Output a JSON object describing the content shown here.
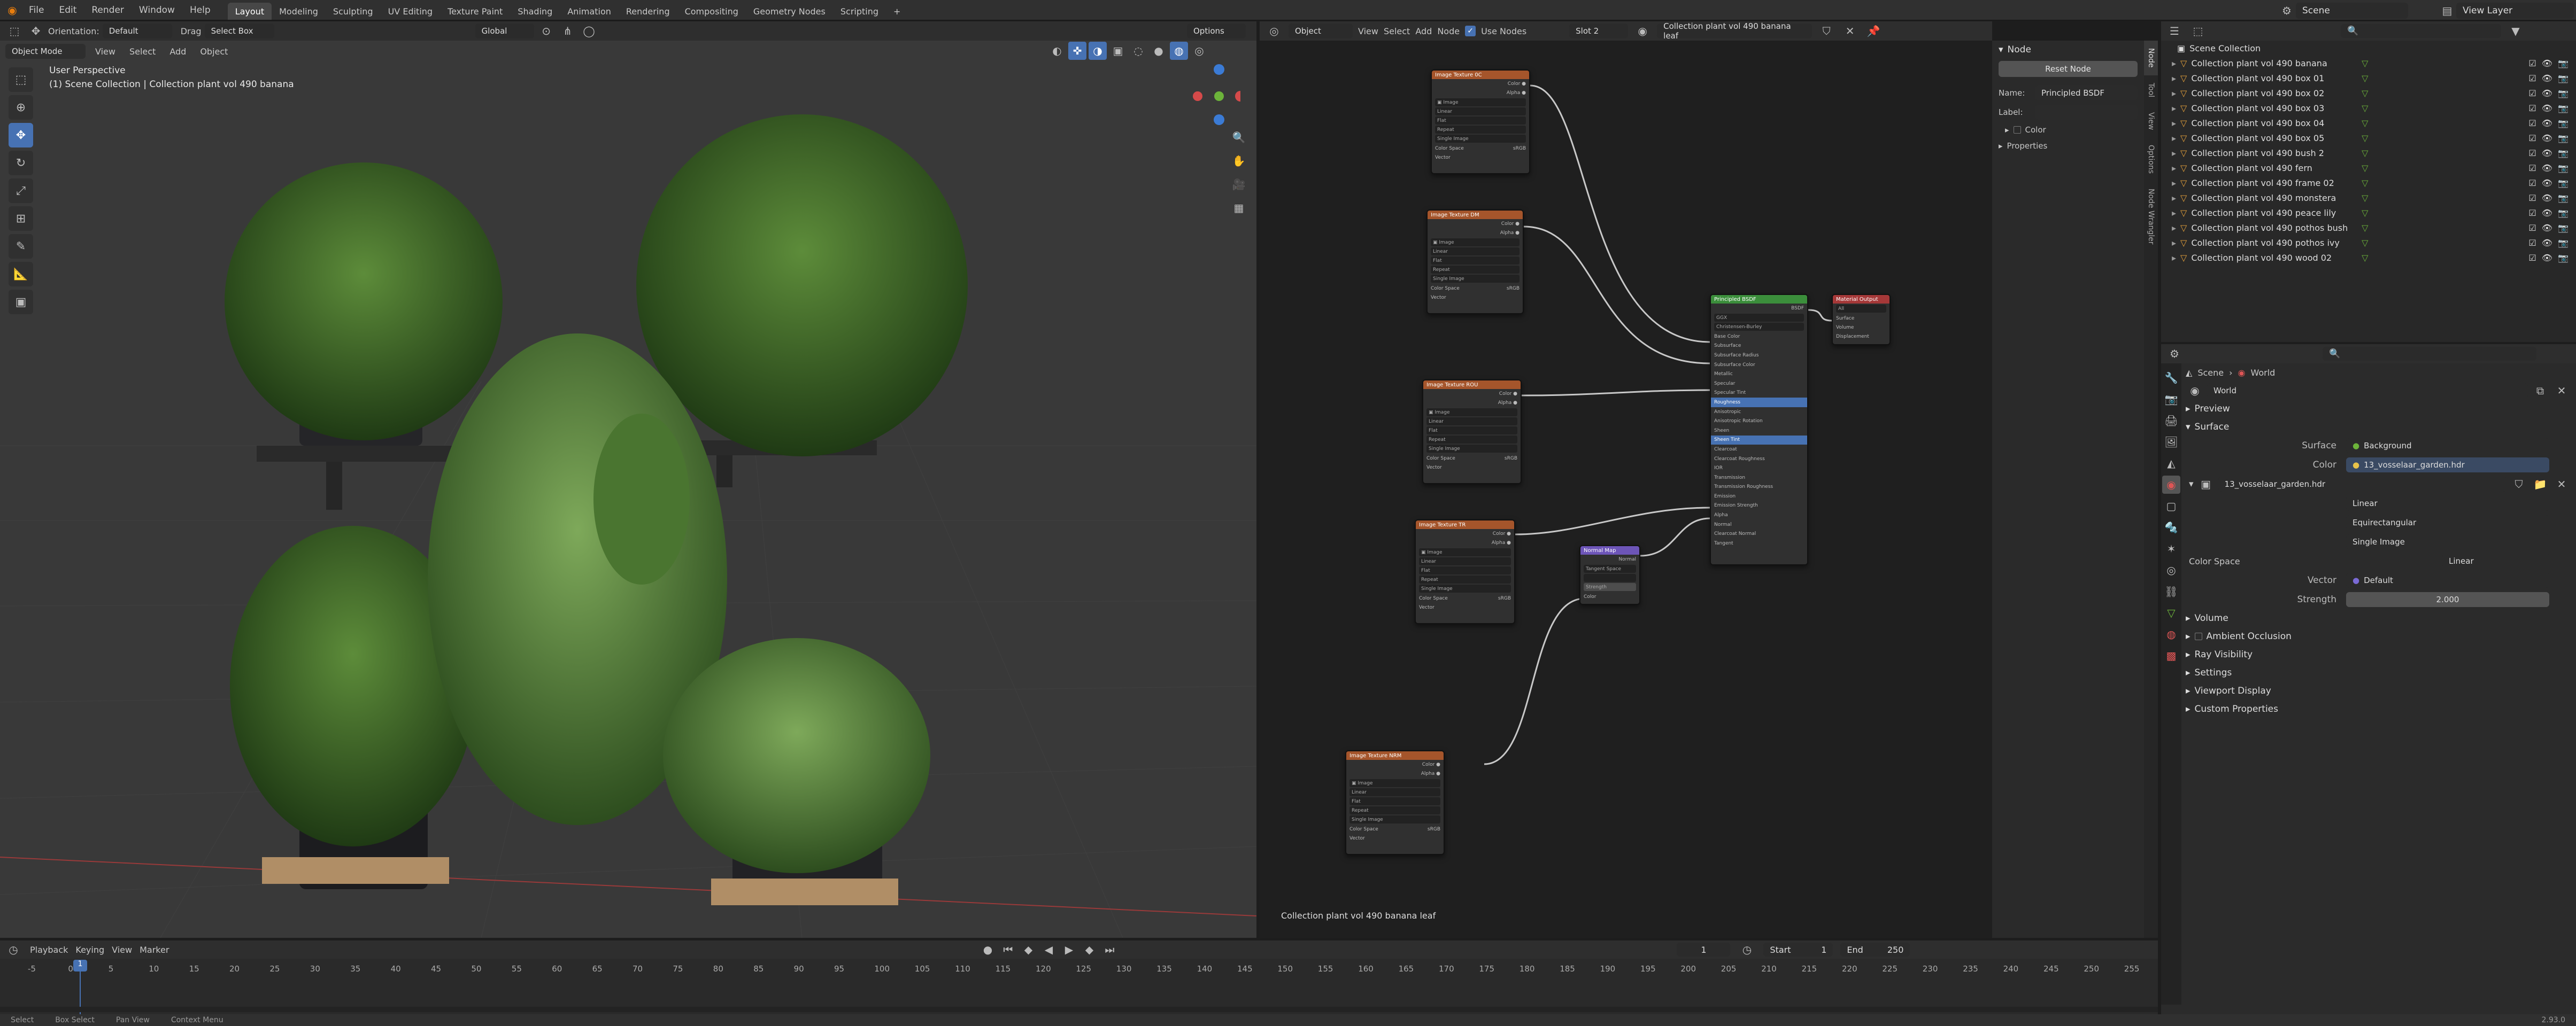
{
  "topbar": {
    "menus": [
      "File",
      "Edit",
      "Render",
      "Window",
      "Help"
    ],
    "workspaces": [
      "Layout",
      "Modeling",
      "Sculpting",
      "UV Editing",
      "Texture Paint",
      "Shading",
      "Animation",
      "Rendering",
      "Compositing",
      "Geometry Nodes",
      "Scripting"
    ],
    "active_workspace": "Layout",
    "scene": "Scene",
    "view_layer": "View Layer"
  },
  "viewport": {
    "orientation_label": "Orientation:",
    "orientation_value": "Default",
    "drag_label": "Drag",
    "drag_value": "Select Box",
    "transform_space": "Global",
    "options": "Options",
    "mode": "Object Mode",
    "menus": [
      "View",
      "Select",
      "Add",
      "Object"
    ],
    "overlay_title": "User Perspective",
    "overlay_sub": "(1) Scene Collection | Collection plant vol 490 banana"
  },
  "node_editor": {
    "type": "Object",
    "menus": [
      "View",
      "Select",
      "Add",
      "Node"
    ],
    "use_nodes_label": "Use Nodes",
    "slot": "Slot 2",
    "material": "Collection plant vol 490 banana leaf",
    "footer": "Collection plant vol 490 banana leaf",
    "image_nodes": [
      {
        "title": "Image Texture 0C",
        "rows": [
          "Linear",
          "Flat",
          "Repeat",
          "Single Image"
        ],
        "cs_label": "Color Space",
        "cs": "sRGB",
        "vec": "Vector"
      },
      {
        "title": "Image Texture DM",
        "rows": [
          "Linear",
          "Flat",
          "Repeat",
          "Single Image"
        ],
        "cs_label": "Color Space",
        "cs": "sRGB",
        "vec": "Vector"
      },
      {
        "title": "Image Texture ROU",
        "rows": [
          "Linear",
          "Flat",
          "Repeat",
          "Single Image"
        ],
        "cs_label": "Color Space",
        "cs": "sRGB",
        "vec": "Vector"
      },
      {
        "title": "Image Texture TR",
        "rows": [
          "Linear",
          "Flat",
          "Repeat",
          "Single Image"
        ],
        "cs_label": "Color Space",
        "cs": "sRGB",
        "vec": "Vector"
      },
      {
        "title": "Image Texture NRM",
        "rows": [
          "Linear",
          "Flat",
          "Repeat",
          "Single Image"
        ],
        "cs_label": "Color Space",
        "cs": "sRGB",
        "vec": "Vector"
      }
    ],
    "normal_map": {
      "title": "Normal Map",
      "out": "Normal",
      "space": "Tangent Space",
      "strength": "Strength",
      "color": "Color"
    },
    "bsdf": {
      "title": "Principled BSDF",
      "out": "BSDF",
      "rows": [
        "GGX",
        "Christensen-Burley",
        "Base Color",
        "Subsurface",
        "Subsurface Radius",
        "Subsurface Color",
        "Metallic",
        "Specular",
        "Specular Tint",
        "Roughness",
        "Anisotropic",
        "Anisotropic Rotation",
        "Sheen",
        "Sheen Tint",
        "Clearcoat",
        "Clearcoat Roughness",
        "IOR",
        "Transmission",
        "Transmission Roughness",
        "Emission",
        "Emission Strength",
        "Alpha",
        "Normal",
        "Clearcoat Normal",
        "Tangent"
      ]
    },
    "output": {
      "title": "Material Output",
      "rows": [
        "All",
        "Surface",
        "Volume",
        "Displacement"
      ]
    }
  },
  "npanel": {
    "section": "Node",
    "reset": "Reset Node",
    "name_label": "Name:",
    "name_value": "Principled BSDF",
    "label_label": "Label:",
    "color": "Color",
    "properties": "Properties",
    "tabs": [
      "Node",
      "Tool",
      "View",
      "Options",
      "Node Wrangler"
    ]
  },
  "outliner": {
    "root": "Scene Collection",
    "items": [
      "Collection plant vol 490 banana",
      "Collection plant vol 490 box 01",
      "Collection plant vol 490 box 02",
      "Collection plant vol 490 box 03",
      "Collection plant vol 490 box 04",
      "Collection plant vol 490 box 05",
      "Collection plant vol 490 bush 2",
      "Collection plant vol 490 fern",
      "Collection plant vol 490 frame 02",
      "Collection plant vol 490 monstera",
      "Collection plant vol 490 peace lily",
      "Collection plant vol 490 pothos bush",
      "Collection plant vol 490 pothos ivy",
      "Collection plant vol 490 wood 02"
    ]
  },
  "properties": {
    "breadcrumb_scene": "Scene",
    "breadcrumb_world": "World",
    "world_name": "World",
    "preview": "Preview",
    "surface": "Surface",
    "surface_label": "Surface",
    "surface_value": "Background",
    "color_label": "Color",
    "color_value": "13_vosselaar_garden.hdr",
    "image_name": "13_vosselaar_garden.hdr",
    "interp": "Linear",
    "projection": "Equirectangular",
    "source": "Single Image",
    "cs_label": "Color Space",
    "cs_value": "Linear",
    "vector_label": "Vector",
    "vector_value": "Default",
    "strength_label": "Strength",
    "strength_value": "2.000",
    "panels": [
      "Volume",
      "Ambient Occlusion",
      "Ray Visibility",
      "Settings",
      "Viewport Display",
      "Custom Properties"
    ]
  },
  "timeline": {
    "menus": [
      "Playback",
      "Keying",
      "View",
      "Marker"
    ],
    "current_frame": "1",
    "start_label": "Start",
    "start": "1",
    "end_label": "End",
    "end": "250",
    "ticks": [
      "-5",
      "0",
      "5",
      "10",
      "15",
      "20",
      "25",
      "30",
      "35",
      "40",
      "45",
      "50",
      "55",
      "60",
      "65",
      "70",
      "75",
      "80",
      "85",
      "90",
      "95",
      "100",
      "105",
      "110",
      "115",
      "120",
      "125",
      "130",
      "135",
      "140",
      "145",
      "150",
      "155",
      "160",
      "165",
      "170",
      "175",
      "180",
      "185",
      "190",
      "195",
      "200",
      "205",
      "210",
      "215",
      "220",
      "225",
      "230",
      "235",
      "240",
      "245",
      "250",
      "255"
    ],
    "cursor_label": "1"
  },
  "status": {
    "items": [
      "Select",
      "Box Select",
      "Pan View",
      "Context Menu"
    ],
    "version": "2.93.0"
  }
}
